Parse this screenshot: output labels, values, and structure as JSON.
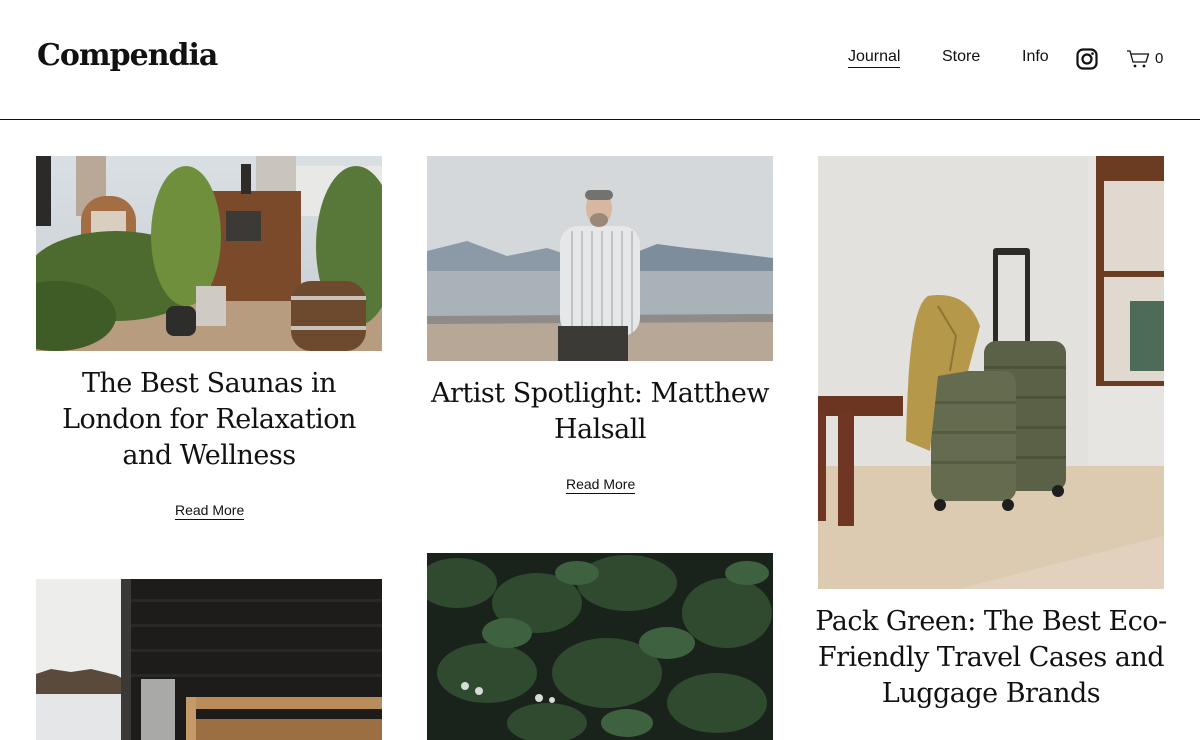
{
  "brand": "Compendia",
  "nav": {
    "journal": "Journal",
    "store": "Store",
    "info": "Info",
    "cart_count": "0"
  },
  "icons": {
    "social": "instagram-icon",
    "cart": "cart-icon"
  },
  "posts": [
    {
      "title": "The Best Saunas in London for Relaxation and Wellness",
      "link": "Read More"
    },
    {
      "title": "Artist Spotlight: Matthew Halsall",
      "link": "Read More"
    },
    {
      "title": "Pack Green: The Best Eco-Friendly Travel Cases and Luggage Brands"
    }
  ],
  "colors": {
    "text": "#111111",
    "background": "#ffffff"
  }
}
